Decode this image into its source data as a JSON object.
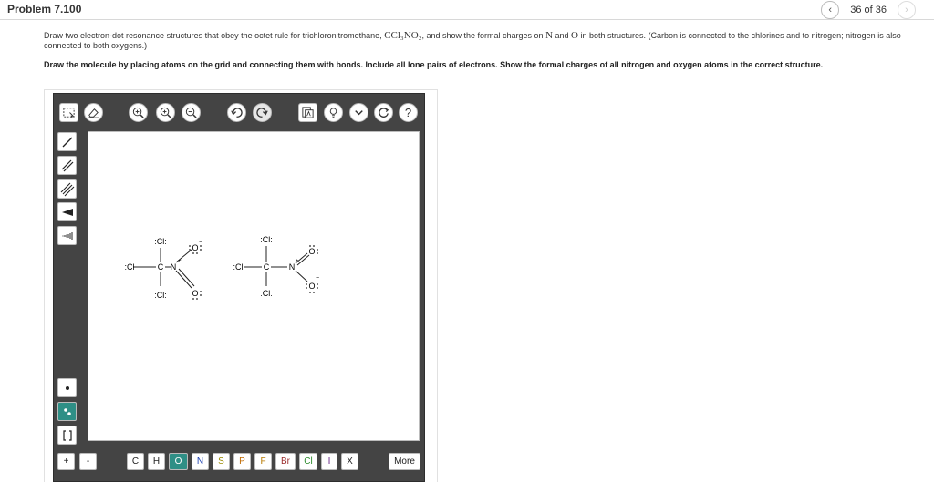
{
  "header": {
    "problem_title": "Problem 7.100",
    "page_count": "36 of 36",
    "prev_icon": "chevron-left-icon",
    "next_icon": "chevron-right-icon"
  },
  "prompt": {
    "text_before": "Draw two electron-dot resonance structures that obey the octet rule for trichloronitromethane, ",
    "formula": "CCl₃NO₂",
    "text_middle": ", and show the formal charges on ",
    "n_symbol": "N",
    "text_and": " and ",
    "o_symbol": "O",
    "text_after": " in both structures. (Carbon is connected to the chlorines and to nitrogen; nitrogen is also connected to both oxygens.)"
  },
  "instructions": "Draw the molecule by placing atoms on the grid and connecting them with bonds. Include all lone pairs of electrons. Show the formal charges of all nitrogen and oxygen atoms in the correct structure.",
  "toolbar": {
    "tools": [
      "select-icon",
      "eraser-icon",
      "zoom-fit-icon",
      "zoom-in-icon",
      "zoom-out-icon",
      "undo-icon",
      "redo-icon",
      "templates-icon",
      "hint-icon",
      "more-chevron-icon",
      "reset-icon",
      "help-icon"
    ]
  },
  "left_tools": [
    "single-bond-icon",
    "double-bond-icon",
    "triple-bond-icon",
    "wedge-bond-icon",
    "hash-bond-icon",
    "radical-icon",
    "lone-pair-icon",
    "bracket-icon"
  ],
  "structures": {
    "left": {
      "cl_top": ":Cl:",
      "cl_left": ":Cl",
      "cl_bottom": ":Cl:",
      "carbon": "C",
      "nitrogen": "N",
      "o_top": "O",
      "o_bottom": "O",
      "charge_n": "+",
      "charge_o": "−"
    },
    "right": {
      "cl_top": ":Cl:",
      "cl_left": ":Cl",
      "cl_bottom": ":Cl:",
      "carbon": "C",
      "nitrogen": "N",
      "o_top": "O",
      "o_bottom": "O",
      "charge_n": "+",
      "charge_o": "−"
    }
  },
  "bottom_bar": {
    "plus": "+",
    "minus": "-",
    "elements": [
      "C",
      "H",
      "O",
      "N",
      "S",
      "P",
      "F",
      "Br",
      "Cl",
      "I",
      "X"
    ],
    "active_element": "O",
    "more_label": "More"
  }
}
